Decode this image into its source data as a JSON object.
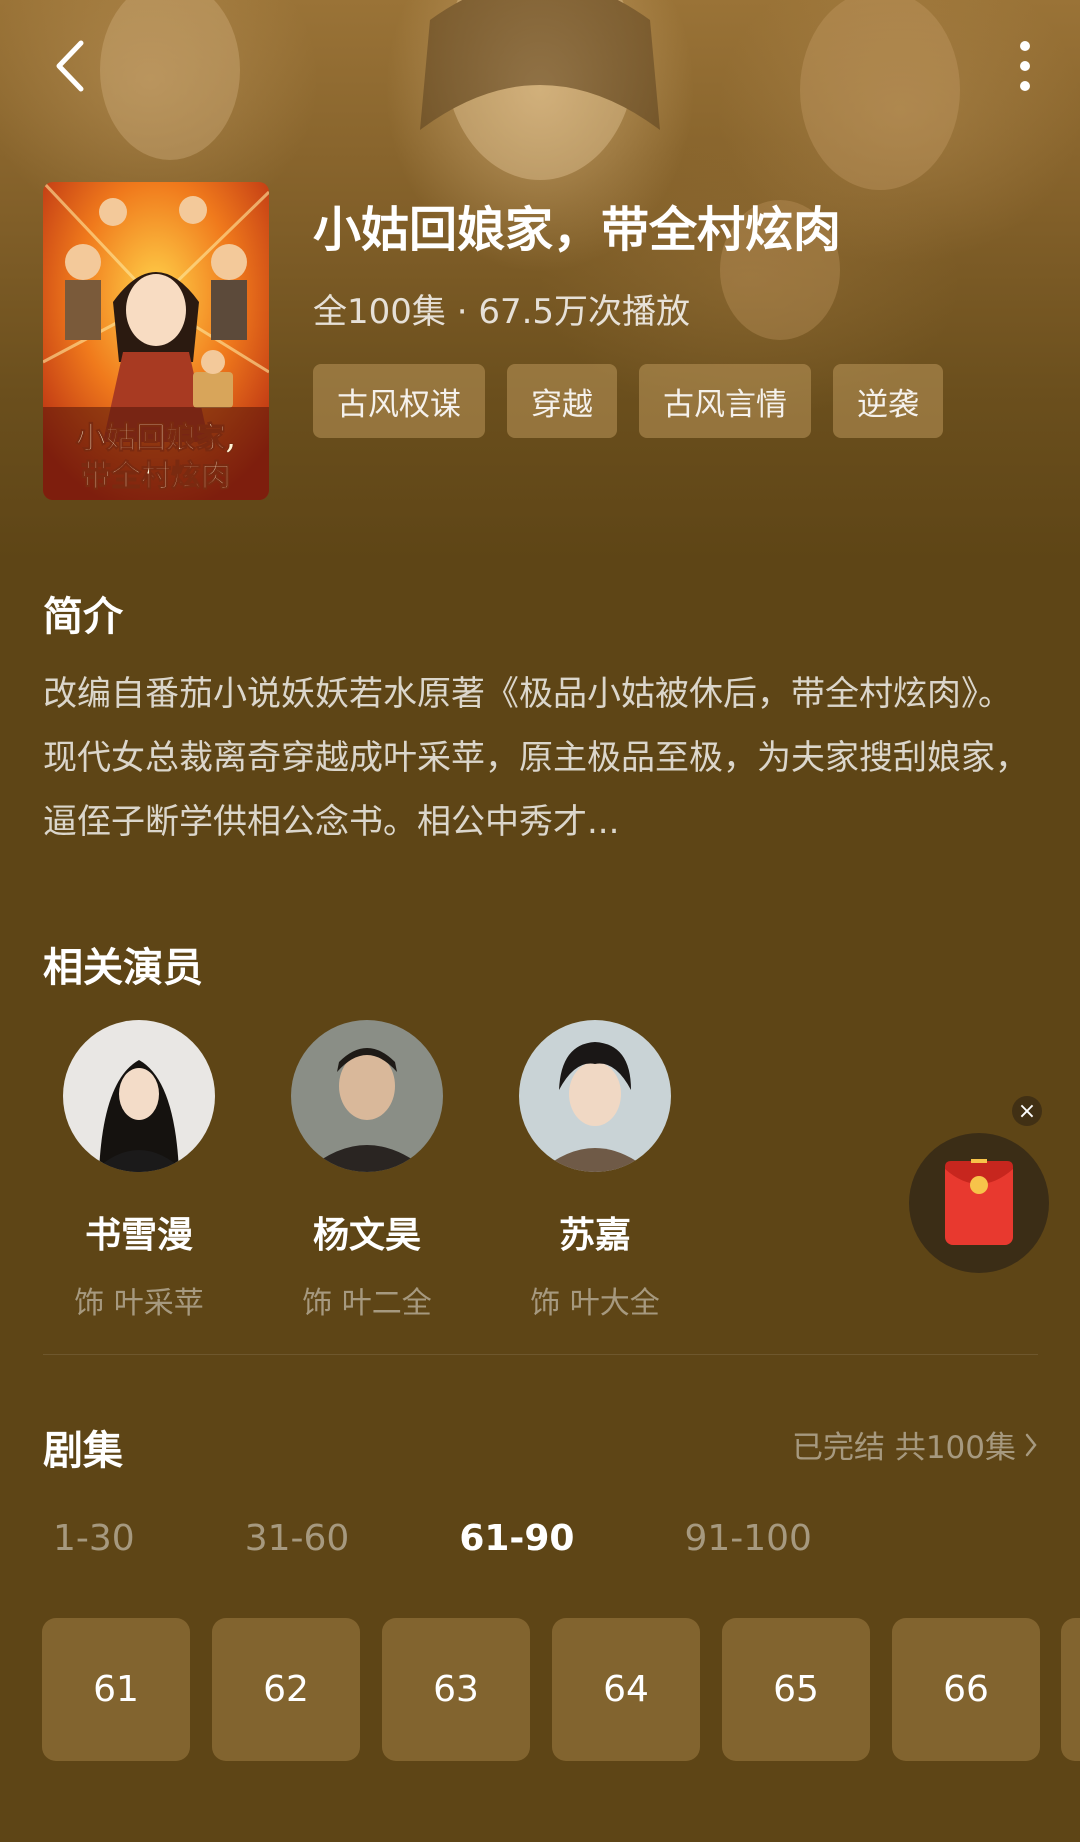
{
  "header": {
    "back_icon": "chevron-left-icon",
    "more_icon": "more-vertical-icon"
  },
  "drama": {
    "title": "小姑回娘家，带全村炫肉",
    "meta": "全100集 · 67.5万次播放",
    "poster_text_line1": "小姑回娘家,",
    "poster_text_line2": "带全村炫肉",
    "tags": [
      "古风权谋",
      "穿越",
      "古风言情",
      "逆袭"
    ]
  },
  "synopsis": {
    "heading": "简介",
    "text": "改编自番茄小说妖妖若水原著《极品小姑被休后，带全村炫肉》。现代女总裁离奇穿越成叶采苹，原主极品至极，为夫家搜刮娘家，逼侄子断学供相公念书。相公中秀才..."
  },
  "cast": {
    "heading": "相关演员",
    "members": [
      {
        "name": "书雪漫",
        "role": "饰 叶采苹"
      },
      {
        "name": "杨文昊",
        "role": "饰 叶二全"
      },
      {
        "name": "苏嘉",
        "role": "饰 叶大全"
      }
    ]
  },
  "episodes": {
    "heading": "剧集",
    "status": "已完结 共100集",
    "ranges": [
      "1-30",
      "31-60",
      "61-90",
      "91-100"
    ],
    "active_range": "61-90",
    "items": [
      "61",
      "62",
      "63",
      "64",
      "65",
      "66"
    ]
  },
  "colors": {
    "background": "#5e4516",
    "tag_bg": "#b9965a",
    "red_packet": "#e8392f"
  }
}
